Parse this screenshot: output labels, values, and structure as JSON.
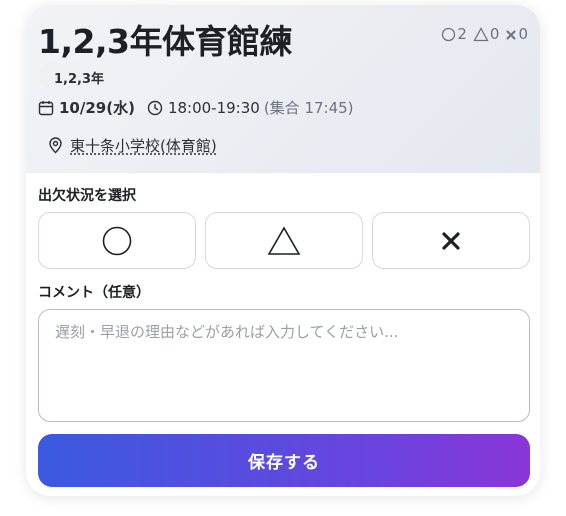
{
  "event": {
    "title": "1,2,3年体育館練",
    "grade": "1,2,3年",
    "date": "10/29(水)",
    "time": "18:00-19:30",
    "assembly": "(集合 17:45)",
    "location": "東十条小学校(体育館)"
  },
  "counts": {
    "present": "2",
    "maybe": "0",
    "absent": "0"
  },
  "attendance": {
    "label": "出欠状況を選択",
    "options": [
      "present",
      "maybe",
      "absent"
    ]
  },
  "comment": {
    "label": "コメント（任意）",
    "placeholder": "遅刻・早退の理由などがあれば入力してください...",
    "value": ""
  },
  "save_label": "保存する",
  "colors": {
    "accent_start": "#3b5ae0",
    "accent_end": "#8a35d8"
  }
}
